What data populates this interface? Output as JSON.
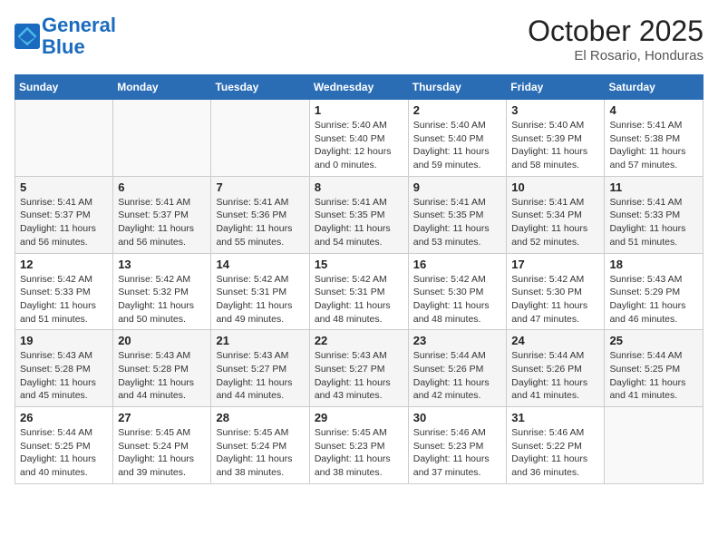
{
  "header": {
    "logo_line1": "General",
    "logo_line2": "Blue",
    "month": "October 2025",
    "location": "El Rosario, Honduras"
  },
  "weekdays": [
    "Sunday",
    "Monday",
    "Tuesday",
    "Wednesday",
    "Thursday",
    "Friday",
    "Saturday"
  ],
  "weeks": [
    [
      {
        "day": "",
        "info": ""
      },
      {
        "day": "",
        "info": ""
      },
      {
        "day": "",
        "info": ""
      },
      {
        "day": "1",
        "info": "Sunrise: 5:40 AM\nSunset: 5:40 PM\nDaylight: 12 hours\nand 0 minutes."
      },
      {
        "day": "2",
        "info": "Sunrise: 5:40 AM\nSunset: 5:40 PM\nDaylight: 11 hours\nand 59 minutes."
      },
      {
        "day": "3",
        "info": "Sunrise: 5:40 AM\nSunset: 5:39 PM\nDaylight: 11 hours\nand 58 minutes."
      },
      {
        "day": "4",
        "info": "Sunrise: 5:41 AM\nSunset: 5:38 PM\nDaylight: 11 hours\nand 57 minutes."
      }
    ],
    [
      {
        "day": "5",
        "info": "Sunrise: 5:41 AM\nSunset: 5:37 PM\nDaylight: 11 hours\nand 56 minutes."
      },
      {
        "day": "6",
        "info": "Sunrise: 5:41 AM\nSunset: 5:37 PM\nDaylight: 11 hours\nand 56 minutes."
      },
      {
        "day": "7",
        "info": "Sunrise: 5:41 AM\nSunset: 5:36 PM\nDaylight: 11 hours\nand 55 minutes."
      },
      {
        "day": "8",
        "info": "Sunrise: 5:41 AM\nSunset: 5:35 PM\nDaylight: 11 hours\nand 54 minutes."
      },
      {
        "day": "9",
        "info": "Sunrise: 5:41 AM\nSunset: 5:35 PM\nDaylight: 11 hours\nand 53 minutes."
      },
      {
        "day": "10",
        "info": "Sunrise: 5:41 AM\nSunset: 5:34 PM\nDaylight: 11 hours\nand 52 minutes."
      },
      {
        "day": "11",
        "info": "Sunrise: 5:41 AM\nSunset: 5:33 PM\nDaylight: 11 hours\nand 51 minutes."
      }
    ],
    [
      {
        "day": "12",
        "info": "Sunrise: 5:42 AM\nSunset: 5:33 PM\nDaylight: 11 hours\nand 51 minutes."
      },
      {
        "day": "13",
        "info": "Sunrise: 5:42 AM\nSunset: 5:32 PM\nDaylight: 11 hours\nand 50 minutes."
      },
      {
        "day": "14",
        "info": "Sunrise: 5:42 AM\nSunset: 5:31 PM\nDaylight: 11 hours\nand 49 minutes."
      },
      {
        "day": "15",
        "info": "Sunrise: 5:42 AM\nSunset: 5:31 PM\nDaylight: 11 hours\nand 48 minutes."
      },
      {
        "day": "16",
        "info": "Sunrise: 5:42 AM\nSunset: 5:30 PM\nDaylight: 11 hours\nand 48 minutes."
      },
      {
        "day": "17",
        "info": "Sunrise: 5:42 AM\nSunset: 5:30 PM\nDaylight: 11 hours\nand 47 minutes."
      },
      {
        "day": "18",
        "info": "Sunrise: 5:43 AM\nSunset: 5:29 PM\nDaylight: 11 hours\nand 46 minutes."
      }
    ],
    [
      {
        "day": "19",
        "info": "Sunrise: 5:43 AM\nSunset: 5:28 PM\nDaylight: 11 hours\nand 45 minutes."
      },
      {
        "day": "20",
        "info": "Sunrise: 5:43 AM\nSunset: 5:28 PM\nDaylight: 11 hours\nand 44 minutes."
      },
      {
        "day": "21",
        "info": "Sunrise: 5:43 AM\nSunset: 5:27 PM\nDaylight: 11 hours\nand 44 minutes."
      },
      {
        "day": "22",
        "info": "Sunrise: 5:43 AM\nSunset: 5:27 PM\nDaylight: 11 hours\nand 43 minutes."
      },
      {
        "day": "23",
        "info": "Sunrise: 5:44 AM\nSunset: 5:26 PM\nDaylight: 11 hours\nand 42 minutes."
      },
      {
        "day": "24",
        "info": "Sunrise: 5:44 AM\nSunset: 5:26 PM\nDaylight: 11 hours\nand 41 minutes."
      },
      {
        "day": "25",
        "info": "Sunrise: 5:44 AM\nSunset: 5:25 PM\nDaylight: 11 hours\nand 41 minutes."
      }
    ],
    [
      {
        "day": "26",
        "info": "Sunrise: 5:44 AM\nSunset: 5:25 PM\nDaylight: 11 hours\nand 40 minutes."
      },
      {
        "day": "27",
        "info": "Sunrise: 5:45 AM\nSunset: 5:24 PM\nDaylight: 11 hours\nand 39 minutes."
      },
      {
        "day": "28",
        "info": "Sunrise: 5:45 AM\nSunset: 5:24 PM\nDaylight: 11 hours\nand 38 minutes."
      },
      {
        "day": "29",
        "info": "Sunrise: 5:45 AM\nSunset: 5:23 PM\nDaylight: 11 hours\nand 38 minutes."
      },
      {
        "day": "30",
        "info": "Sunrise: 5:46 AM\nSunset: 5:23 PM\nDaylight: 11 hours\nand 37 minutes."
      },
      {
        "day": "31",
        "info": "Sunrise: 5:46 AM\nSunset: 5:22 PM\nDaylight: 11 hours\nand 36 minutes."
      },
      {
        "day": "",
        "info": ""
      }
    ]
  ]
}
